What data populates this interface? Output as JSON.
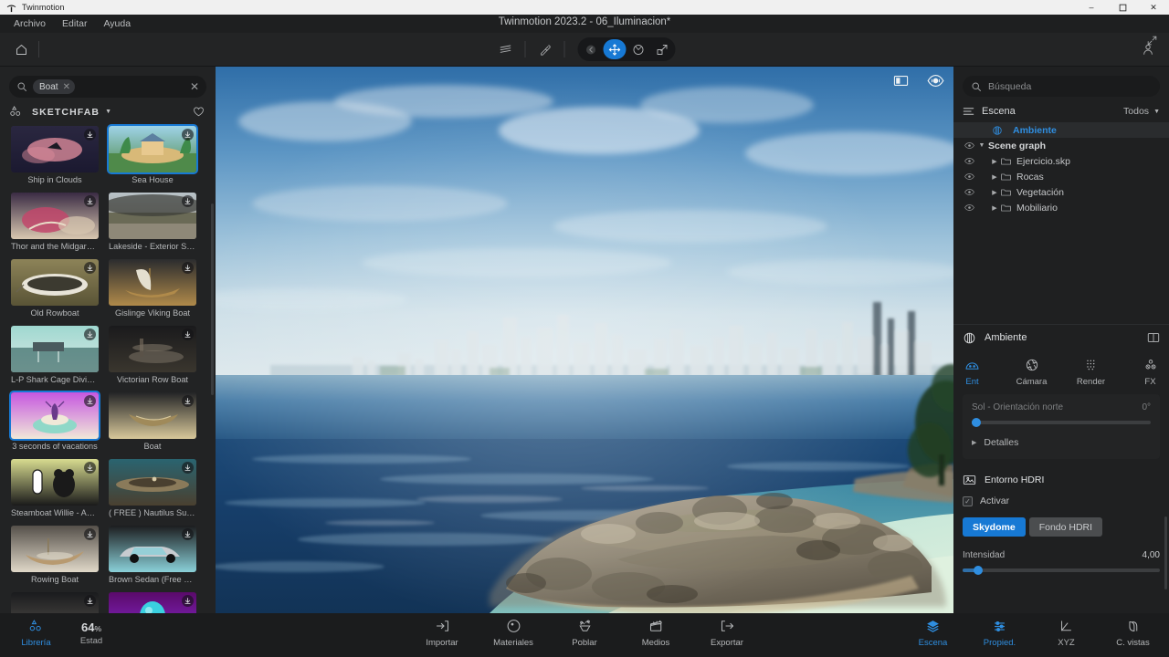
{
  "window": {
    "app_name": "Twinmotion",
    "title": "Twinmotion 2023.2 - 06_Iluminacion*",
    "controls": {
      "minimize": "–",
      "maximize": "❒",
      "close": "✕"
    }
  },
  "menubar": {
    "items": [
      "Archivo",
      "Editar",
      "Ayuda"
    ]
  },
  "toolbar": {
    "home_icon": "home-icon",
    "layers_icon": "layers-icon",
    "eyedropper_icon": "eyedropper-icon",
    "gizmo": [
      {
        "name": "back-arrow",
        "active": false,
        "dim": true
      },
      {
        "name": "move-gizmo",
        "active": true,
        "dim": false
      },
      {
        "name": "rotate-gizmo",
        "active": false,
        "dim": false
      },
      {
        "name": "scale-gizmo",
        "active": false,
        "dim": false
      }
    ],
    "expand_icon": "expand-icon",
    "account_icon": "account-icon"
  },
  "library": {
    "search": {
      "placeholder": "",
      "chip": "Boat",
      "chip_remove": "✕",
      "clear": "✕"
    },
    "source": {
      "label": "SKETCHFAB",
      "caret": "▼",
      "favorite_icon": "heart-icon"
    },
    "items": [
      {
        "title": "Ship in Clouds",
        "selected": false,
        "c1": "#2a2740",
        "c2": "#d98a9a",
        "c3": "#1b1930",
        "style": "clouds"
      },
      {
        "title": "Sea House",
        "selected": true,
        "c1": "#9fd3e8",
        "c2": "#e8c98f",
        "c3": "#4f8a4a",
        "style": "house"
      },
      {
        "title": "Thor and the Midgard S...",
        "selected": false,
        "c1": "#3a2b44",
        "c2": "#c2476b",
        "c3": "#d9c8b0",
        "style": "thor"
      },
      {
        "title": "Lakeside - Exterior Sce...",
        "selected": false,
        "c1": "#b9c3c9",
        "c2": "#5a5b4e",
        "c3": "#8a8272",
        "style": "lake"
      },
      {
        "title": "Old Rowboat",
        "selected": false,
        "c1": "#8d8358",
        "c2": "#e8e4d8",
        "c3": "#5a5436",
        "style": "rowboat"
      },
      {
        "title": "Gislinge Viking Boat",
        "selected": false,
        "c1": "#2b2c2e",
        "c2": "#e4dfcf",
        "c3": "#b08a4a",
        "style": "viking"
      },
      {
        "title": "L-P Shark Cage Diving...",
        "selected": false,
        "c1": "#9fd8d0",
        "c2": "#3d6b68",
        "c3": "#d8e8e4",
        "style": "shark"
      },
      {
        "title": "Victorian Row Boat",
        "selected": false,
        "c1": "#1a1a1c",
        "c2": "#6b6458",
        "c3": "#3a362e",
        "style": "victorian"
      },
      {
        "title": "3 seconds of vacations",
        "selected": true,
        "c1": "#c657e0",
        "c2": "#8fd8c8",
        "c3": "#f0e8d8",
        "style": "vacation"
      },
      {
        "title": "Boat",
        "selected": false,
        "c1": "#232426",
        "c2": "#a08a5a",
        "c3": "#d8c89a",
        "style": "boat"
      },
      {
        "title": "Steamboat Willie - Ani...",
        "selected": false,
        "c1": "#d8dc90",
        "c2": "#ffffff",
        "c3": "#1a1a1a",
        "style": "willie"
      },
      {
        "title": "( FREE ) Nautilus Subm...",
        "selected": false,
        "c1": "#2a6470",
        "c2": "#8a7a5a",
        "c3": "#4a4030",
        "style": "nautilus"
      },
      {
        "title": "Rowing Boat",
        "selected": false,
        "c1": "#55504a",
        "c2": "#b89a70",
        "c3": "#e0d8c8",
        "style": "rowing"
      },
      {
        "title": "Brown Sedan (Free Ra...",
        "selected": false,
        "c1": "#1c1d1f",
        "c2": "#c8ccd0",
        "c3": "#8ad0d8",
        "style": "sedan"
      },
      {
        "title": "",
        "selected": false,
        "c1": "#1a1b1d",
        "c2": "#d8d4cc",
        "c3": "#5a5650",
        "style": "plain"
      },
      {
        "title": "",
        "selected": false,
        "c1": "#5a0a6a",
        "c2": "#3ad0e0",
        "c3": "#8a2ad0",
        "style": "neon"
      }
    ],
    "download_icon": "download-icon"
  },
  "viewport": {
    "panel_icon": "panel-toggle-icon",
    "eye_icon": "eye-visibility-icon",
    "scene_description": "Tropical island with rocky outcrop, turquoise lagoon and distant city skyline under a blue sky with clouds"
  },
  "scene": {
    "search_placeholder": "Búsqueda",
    "header": {
      "label": "Escena",
      "filter": "Todos",
      "filter_caret": "▼",
      "menu_icon": "hamburger-icon"
    },
    "tree": [
      {
        "label": "Ambiente",
        "depth": 0,
        "selected": true,
        "icon": "ambient-icon",
        "eye": false,
        "twisty": ""
      },
      {
        "label": "Scene graph",
        "depth": 0,
        "selected": false,
        "icon": "",
        "eye": true,
        "twisty": "▼"
      },
      {
        "label": "Ejercicio.skp",
        "depth": 1,
        "selected": false,
        "icon": "folder-icon",
        "eye": true,
        "twisty": "▶"
      },
      {
        "label": "Rocas",
        "depth": 1,
        "selected": false,
        "icon": "folder-icon",
        "eye": true,
        "twisty": "▶"
      },
      {
        "label": "Vegetación",
        "depth": 1,
        "selected": false,
        "icon": "folder-icon",
        "eye": true,
        "twisty": "▶"
      },
      {
        "label": "Mobiliario",
        "depth": 1,
        "selected": false,
        "icon": "folder-icon",
        "eye": true,
        "twisty": "▶"
      }
    ]
  },
  "properties": {
    "header": {
      "title": "Ambiente",
      "icon": "ambient-icon",
      "split_icon": "split-panel-icon"
    },
    "tabs": [
      {
        "label": "Ent",
        "icon": "environment-icon",
        "active": true
      },
      {
        "label": "Cámara",
        "icon": "camera-aperture-icon",
        "active": false
      },
      {
        "label": "Render",
        "icon": "render-dots-icon",
        "active": false
      },
      {
        "label": "FX",
        "icon": "fx-icon",
        "active": false
      }
    ],
    "sun": {
      "label": "Sol - Orientación norte",
      "value": "0°",
      "percent": 1
    },
    "details": {
      "label": "Detalles",
      "arrow": "▶"
    },
    "hdri": {
      "title": "Entorno HDRI",
      "icon": "hdri-image-icon",
      "activate": {
        "label": "Activar",
        "checked": true,
        "check": "✓"
      },
      "segments": [
        {
          "label": "Skydome",
          "on": true
        },
        {
          "label": "Fondo HDRI",
          "on": false
        }
      ],
      "intensity": {
        "label": "Intensidad",
        "value": "4,00",
        "percent": 8
      }
    }
  },
  "bottom": {
    "left": [
      {
        "label": "Librería",
        "icon": "library-icon",
        "active": true
      }
    ],
    "stat": {
      "value": "64",
      "unit": "%",
      "label": "Estad"
    },
    "center": [
      {
        "label": "Importar",
        "icon": "import-icon"
      },
      {
        "label": "Materiales",
        "icon": "materials-icon"
      },
      {
        "label": "Poblar",
        "icon": "populate-icon"
      },
      {
        "label": "Medios",
        "icon": "media-icon"
      },
      {
        "label": "Exportar",
        "icon": "export-icon"
      }
    ],
    "right": [
      {
        "label": "Escena",
        "icon": "scene-layers-icon",
        "active": true
      },
      {
        "label": "Propied.",
        "icon": "properties-icon",
        "active": true
      },
      {
        "label": "XYZ",
        "icon": "xyz-axis-icon",
        "active": false
      },
      {
        "label": "C. vistas",
        "icon": "viewport-copy-icon",
        "active": false
      }
    ]
  },
  "colors": {
    "accent": "#1779d4",
    "accent_text": "#2f8ee0",
    "panel": "#222324",
    "panel_dark": "#1f2021",
    "toolbar": "#232425"
  }
}
